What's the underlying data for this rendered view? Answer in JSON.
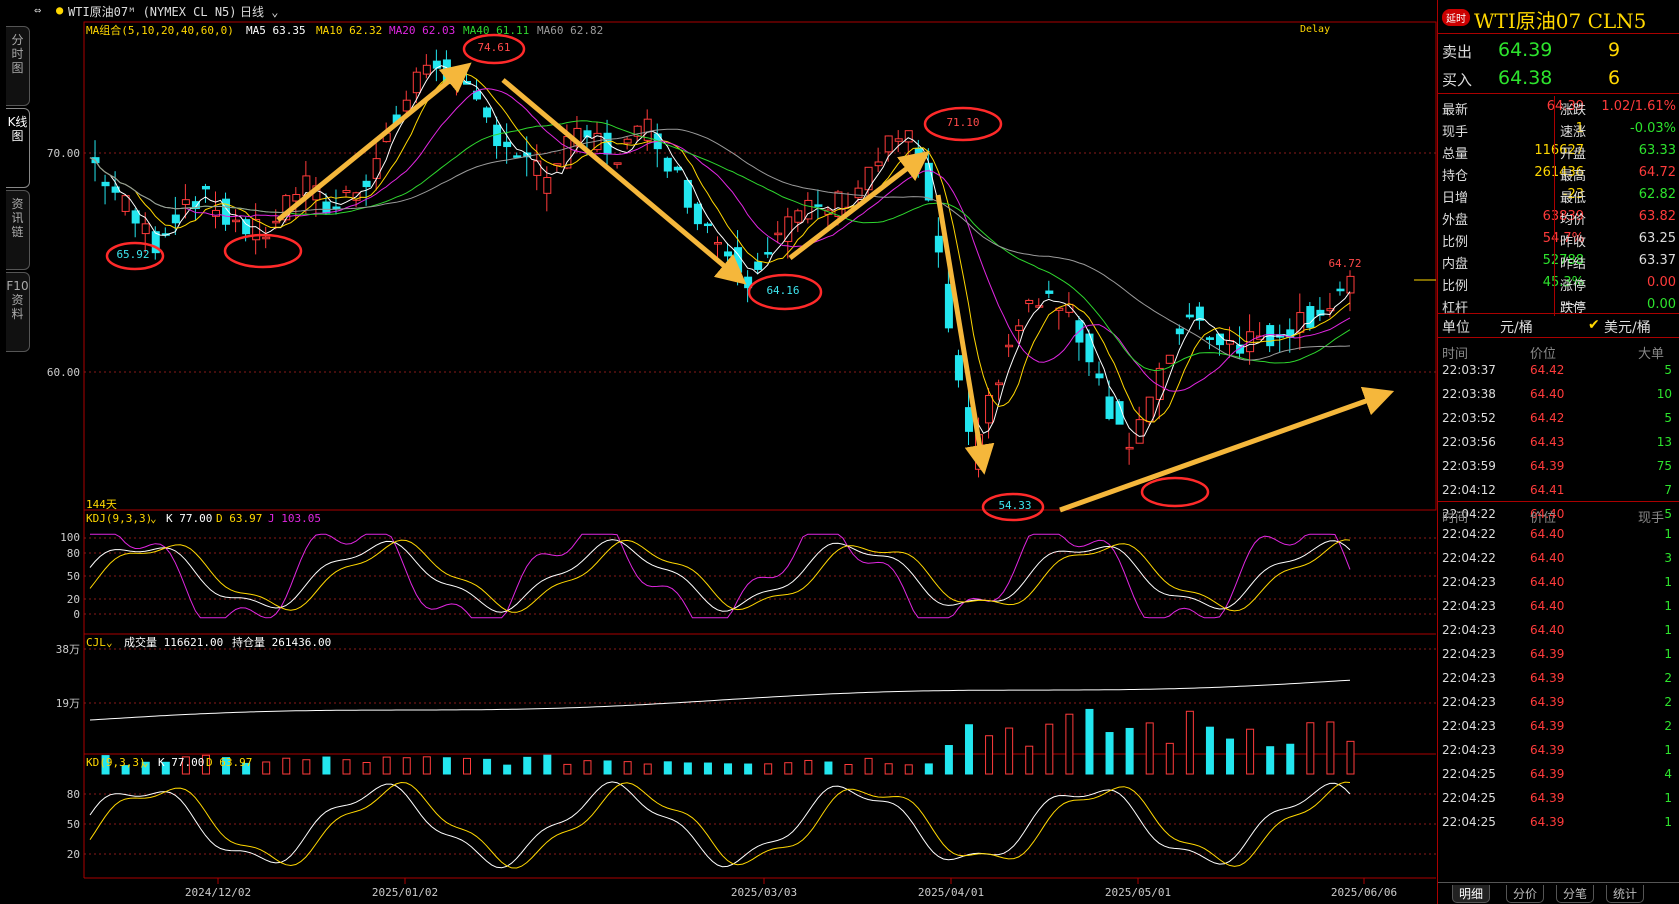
{
  "topbar": {
    "title": "WTI原油07ᴹ (NYMEX CL N5)",
    "period": "日线",
    "delay": "Delay"
  },
  "lefttabs": [
    "分时图",
    "K线图",
    "资讯链",
    "F10资料"
  ],
  "main": {
    "ma_legend": {
      "name": "MA组合(5,10,20,40,60,0)",
      "items": [
        {
          "label": "MA5 63.35",
          "color": "#ffffff"
        },
        {
          "label": "MA10 62.32",
          "color": "#ffd700"
        },
        {
          "label": "MA20 62.03",
          "color": "#e026e0"
        },
        {
          "label": "MA40 61.11",
          "color": "#2ed62e"
        },
        {
          "label": "MA60 62.82",
          "color": "#9a9a9a"
        }
      ]
    },
    "yaxis": [
      "70.00",
      "60.00"
    ],
    "days_label": "144天",
    "last_price_label": "64.72",
    "annotations": [
      "74.61",
      "65.92",
      "64.16",
      "71.10",
      "54.33"
    ],
    "dates": [
      "2024/12/02",
      "2025/01/02",
      "2025/03/03",
      "2025/04/01",
      "2025/05/01",
      "2025/06/06"
    ]
  },
  "kdj": {
    "legend": {
      "name": "KDJ(9,3,3)",
      "k": "K 77.00",
      "d": "D 63.97",
      "j": "J 103.05"
    },
    "yaxis": [
      "100",
      "80",
      "50",
      "20",
      "0"
    ]
  },
  "vol": {
    "legend": {
      "name": "CJL",
      "vol": "成交量 116621.00",
      "oi": "持仓量 261436.00"
    },
    "yaxis": [
      "38万",
      "19万"
    ]
  },
  "kd": {
    "legend": {
      "name": "KD(9,3,3)",
      "k": "K 77.00",
      "d": "D 63.97"
    },
    "yaxis": [
      "80",
      "50",
      "20"
    ]
  },
  "panel": {
    "badge": "延时",
    "title": "WTI原油07  CLN5",
    "orderbook": [
      {
        "label": "卖出",
        "price": "64.39",
        "qty": "9"
      },
      {
        "label": "买入",
        "price": "64.38",
        "qty": "6"
      }
    ],
    "stats": [
      {
        "l1": "最新",
        "v1": "64.39",
        "c1": "#ff3b3b",
        "l2": "涨跌",
        "v2": "1.02/1.61%",
        "c2": "#ff3b3b"
      },
      {
        "l1": "现手",
        "v1": "1",
        "c1": "#ffd700",
        "l2": "速涨",
        "v2": "-0.03%",
        "c2": "#2de32d"
      },
      {
        "l1": "总量",
        "v1": "116627",
        "c1": "#ffd700",
        "l2": "开盘",
        "v2": "63.33",
        "c2": "#2de32d"
      },
      {
        "l1": "持仓",
        "v1": "261436",
        "c1": "#ffd700",
        "l2": "最高",
        "v2": "64.72",
        "c2": "#ff3b3b"
      },
      {
        "l1": "日增",
        "v1": "-23",
        "c1": "#ffd700",
        "l2": "最低",
        "v2": "62.82",
        "c2": "#2de32d"
      },
      {
        "l1": "外盘",
        "v1": "63839",
        "c1": "#ff3b3b",
        "l2": "均价",
        "v2": "63.82",
        "c2": "#ff3b3b"
      },
      {
        "l1": "比例",
        "v1": "54.7%",
        "c1": "#ff3b3b",
        "l2": "昨收",
        "v2": "63.25",
        "c2": "#dddddd"
      },
      {
        "l1": "内盘",
        "v1": "52788",
        "c1": "#2de32d",
        "l2": "昨结",
        "v2": "63.37",
        "c2": "#dddddd"
      },
      {
        "l1": "比例",
        "v1": "45.3%",
        "c1": "#2de32d",
        "l2": "涨停",
        "v2": "0.00",
        "c2": "#ff3b3b"
      },
      {
        "l1": "杠杆",
        "v1": "-----",
        "c1": "#dddddd",
        "l2": "跌停",
        "v2": "0.00",
        "c2": "#2de32d"
      }
    ],
    "unit": {
      "label": "单位",
      "value": "元/桶",
      "option": "美元/桶"
    },
    "big_trades": {
      "headers": [
        "时间",
        "价位",
        "大单"
      ],
      "rows": [
        {
          "t": "22:03:37",
          "p": "64.42",
          "q": "5"
        },
        {
          "t": "22:03:38",
          "p": "64.40",
          "q": "10"
        },
        {
          "t": "22:03:52",
          "p": "64.42",
          "q": "5"
        },
        {
          "t": "22:03:56",
          "p": "64.43",
          "q": "13"
        },
        {
          "t": "22:03:59",
          "p": "64.39",
          "q": "75"
        },
        {
          "t": "22:04:12",
          "p": "64.41",
          "q": "7"
        },
        {
          "t": "22:04:22",
          "p": "64.40",
          "q": "5"
        }
      ]
    },
    "ticks": {
      "headers": [
        "时间",
        "价位",
        "现手"
      ],
      "rows": [
        {
          "t": "22:04:22",
          "p": "64.40",
          "q": "1"
        },
        {
          "t": "22:04:22",
          "p": "64.40",
          "q": "3"
        },
        {
          "t": "22:04:23",
          "p": "64.40",
          "q": "1"
        },
        {
          "t": "22:04:23",
          "p": "64.40",
          "q": "1"
        },
        {
          "t": "22:04:23",
          "p": "64.40",
          "q": "1"
        },
        {
          "t": "22:04:23",
          "p": "64.39",
          "q": "1"
        },
        {
          "t": "22:04:23",
          "p": "64.39",
          "q": "2"
        },
        {
          "t": "22:04:23",
          "p": "64.39",
          "q": "2"
        },
        {
          "t": "22:04:23",
          "p": "64.39",
          "q": "2"
        },
        {
          "t": "22:04:23",
          "p": "64.39",
          "q": "1"
        },
        {
          "t": "22:04:25",
          "p": "64.39",
          "q": "4"
        },
        {
          "t": "22:04:25",
          "p": "64.39",
          "q": "1"
        },
        {
          "t": "22:04:25",
          "p": "64.39",
          "q": "1"
        }
      ]
    },
    "footer_tabs": [
      "明细",
      "分价",
      "分笔",
      "统计"
    ]
  }
}
